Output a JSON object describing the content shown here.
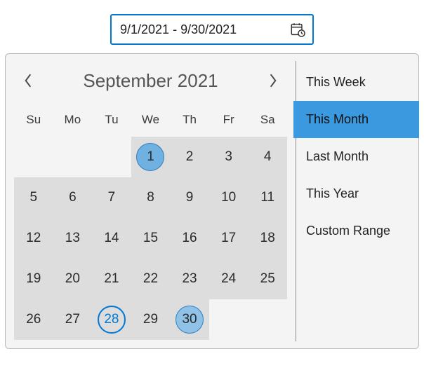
{
  "input": {
    "value": "9/1/2021 - 9/30/2021"
  },
  "header": {
    "month_label": "September 2021"
  },
  "dow": [
    "Su",
    "Mo",
    "Tu",
    "We",
    "Th",
    "Fr",
    "Sa"
  ],
  "days": {
    "row0": [
      "",
      "",
      "",
      "1",
      "2",
      "3",
      "4"
    ],
    "row1": [
      "5",
      "6",
      "7",
      "8",
      "9",
      "10",
      "11"
    ],
    "row2": [
      "12",
      "13",
      "14",
      "15",
      "16",
      "17",
      "18"
    ],
    "row3": [
      "19",
      "20",
      "21",
      "22",
      "23",
      "24",
      "25"
    ],
    "row4": [
      "26",
      "27",
      "28",
      "29",
      "30",
      "",
      ""
    ]
  },
  "range": {
    "start": "1",
    "end": "30",
    "today": "28"
  },
  "presets": {
    "this_week": "This Week",
    "this_month": "This Month",
    "last_month": "Last Month",
    "this_year": "This Year",
    "custom_range": "Custom Range",
    "selected": "this_month"
  },
  "colors": {
    "accent": "#0078d4",
    "preset_selected_bg": "#3b99e0",
    "range_bg": "#dddddd",
    "circle_fill": "#6fb1e0"
  }
}
